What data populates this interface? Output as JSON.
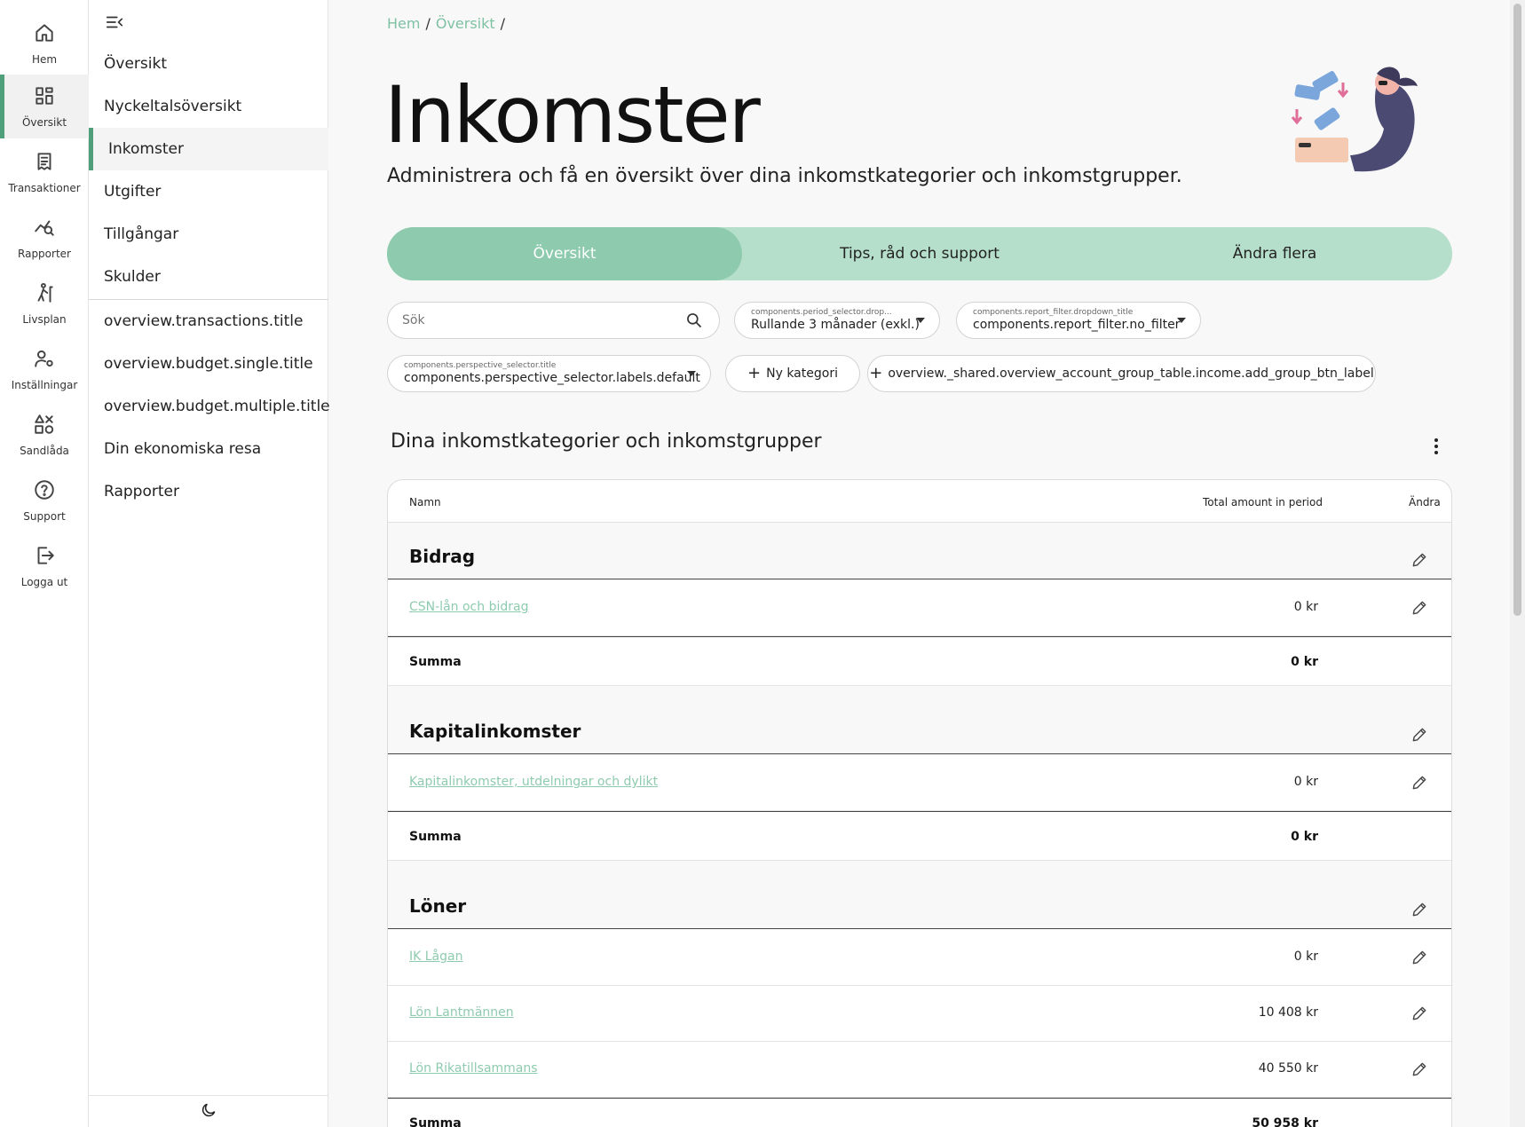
{
  "rail": {
    "items": [
      {
        "label": "Hem",
        "icon": "home-icon"
      },
      {
        "label": "Översikt",
        "icon": "dashboard-icon"
      },
      {
        "label": "Transaktioner",
        "icon": "receipt-icon"
      },
      {
        "label": "Rapporter",
        "icon": "chart-search-icon"
      },
      {
        "label": "Livsplan",
        "icon": "hiker-icon"
      },
      {
        "label": "Inställningar",
        "icon": "user-settings-icon"
      },
      {
        "label": "Sandlåda",
        "icon": "shapes-icon"
      },
      {
        "label": "Support",
        "icon": "help-icon"
      },
      {
        "label": "Logga ut",
        "icon": "logout-icon"
      }
    ],
    "active_index": 1
  },
  "subnav": {
    "items": [
      "Översikt",
      "Nyckeltalsöversikt",
      "Inkomster",
      "Utgifter",
      "Tillgångar",
      "Skulder",
      "overview.transactions.title",
      "overview.budget.single.title",
      "overview.budget.multiple.title",
      "Din ekonomiska resa",
      "Rapporter"
    ],
    "active_index": 2
  },
  "breadcrumb": {
    "items": [
      "Hem",
      "Översikt"
    ],
    "separator": "/"
  },
  "page": {
    "title": "Inkomster",
    "subtitle": "Administrera och få en översikt över dina inkomstkategorier och inkomstgrupper."
  },
  "tabs": [
    {
      "label": "Översikt",
      "active": true
    },
    {
      "label": "Tips, råd och support",
      "active": false
    },
    {
      "label": "Ändra flera",
      "active": false
    }
  ],
  "filters": {
    "search_placeholder": "Sök",
    "period": {
      "title": "components.period_selector.drop...",
      "value": "Rullande 3 månader (exkl.)"
    },
    "report_filter": {
      "title": "components.report_filter.dropdown_title",
      "value": "components.report_filter.no_filter"
    },
    "perspective": {
      "title": "components.perspective_selector.title",
      "value": "components.perspective_selector.labels.default"
    },
    "new_category_label": "Ny kategori",
    "add_group_label": "overview._shared.overview_account_group_table.income.add_group_btn_label"
  },
  "section": {
    "title": "Dina inkomstkategorier och inkomstgrupper"
  },
  "table": {
    "columns": {
      "name": "Namn",
      "amount": "Total amount in period",
      "edit": "Ändra"
    },
    "sum_label": "Summa",
    "groups": [
      {
        "name": "Bidrag",
        "rows": [
          {
            "name": "CSN-lån och bidrag",
            "amount": "0 kr"
          }
        ],
        "sum": "0 kr"
      },
      {
        "name": "Kapitalinkomster",
        "rows": [
          {
            "name": "Kapitalinkomster, utdelningar och dylikt",
            "amount": "0 kr"
          }
        ],
        "sum": "0 kr"
      },
      {
        "name": "Löner",
        "rows": [
          {
            "name": "IK Lågan",
            "amount": "0 kr"
          },
          {
            "name": "Lön Lantmännen",
            "amount": "10 408 kr"
          },
          {
            "name": "Lön Rikatillsammans",
            "amount": "40 550 kr"
          }
        ],
        "sum": "50 958 kr"
      }
    ]
  },
  "colors": {
    "accent": "#4f9f7b",
    "tab_active": "#8ecbae",
    "tab_bg": "#b6dfcb",
    "link": "#8ecbae"
  }
}
